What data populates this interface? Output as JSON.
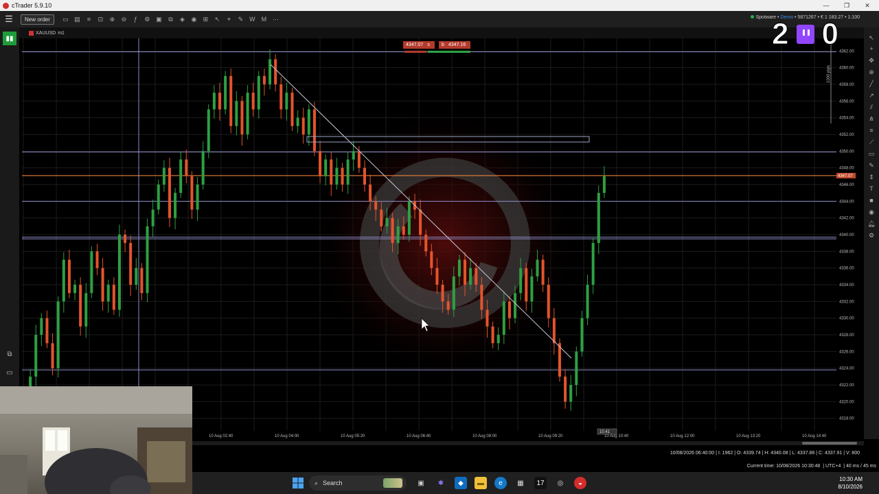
{
  "window": {
    "title": "cTrader 5.9.10"
  },
  "toolbar": {
    "new_order_label": "New order",
    "account": {
      "broker": "Spotware",
      "mode": "Demo",
      "info": "5871267 • € 1 183.27 • 1:100"
    }
  },
  "chart_tab": {
    "symbol": "XAUUSD",
    "timeframe": "m1"
  },
  "quotes": {
    "sell": "4347.07",
    "buy": "4347.16",
    "sell_mark": "s",
    "buy_mark": "b"
  },
  "overlay": {
    "left_digit": "2",
    "right_digit": "0"
  },
  "chart_data": {
    "type": "candlestick",
    "y_axis_labels": [
      "4362.00",
      "4360.00",
      "4358.00",
      "4356.00",
      "4354.00",
      "4352.00",
      "4350.00",
      "4348.00",
      "4346.00",
      "4344.00",
      "4342.00",
      "4340.00",
      "4338.00",
      "4336.00",
      "4334.00",
      "4332.00",
      "4330.00",
      "4328.00",
      "4326.00",
      "4324.00",
      "4322.00",
      "4320.00",
      "4318.00"
    ],
    "x_axis_labels": [
      "10 Aug 02:40",
      "10 Aug 04:00",
      "10 Aug 05:20",
      "10 Aug 06:40",
      "10 Aug 08:00",
      "10 Aug 09:20",
      "10 Aug 10:40",
      "10 Aug 12:00",
      "10 Aug 13:20",
      "10 Aug 14:40"
    ],
    "current_price": "4347.07",
    "price_range": [
      4316.5,
      4363.5
    ],
    "pip_label": "1000 pips",
    "cursor_time_label": "10.41",
    "horizontal_levels": [
      4361.9,
      4349.9,
      4344.0,
      4339.5,
      4339.7,
      4323.8
    ],
    "level_color": "#8e8ec8",
    "current_line_color": "#e8823a",
    "bull_color": "#2ea043",
    "bear_color": "#e4542c",
    "candles_close_path": [
      4318,
      4323,
      4328,
      4330,
      4327,
      4324,
      4332,
      4337,
      4333,
      4334,
      4329,
      4333,
      4338,
      4336,
      4332,
      4334,
      4331,
      4340,
      4339,
      4334,
      4336,
      4333,
      4341,
      4343,
      4346,
      4348,
      4342,
      4345,
      4349,
      4347,
      4343,
      4346,
      4350,
      4355,
      4357,
      4355,
      4359,
      4353,
      4356,
      4352,
      4357,
      4355,
      4359,
      4358,
      4361,
      4358,
      4355,
      4357,
      4353,
      4354,
      4352,
      4355,
      4350,
      4347,
      4349,
      4346,
      4348,
      4346,
      4349,
      4350,
      4348,
      4346,
      4344,
      4343,
      4341,
      4342,
      4339,
      4341,
      4340,
      4344,
      4343,
      4340,
      4338,
      4336,
      4334,
      4332,
      4331,
      4335,
      4337,
      4334,
      4336,
      4334,
      4331,
      4329,
      4327,
      4328,
      4332,
      4330,
      4333,
      4336,
      4332,
      4335,
      4337,
      4334,
      4330,
      4327,
      4323,
      4320,
      4322,
      4326,
      4330,
      4334,
      4339,
      4345,
      4347
    ]
  },
  "status": {
    "bar_info": "10/08/2026 06:40:00 | I: 1962 | O: 4339.74 | H: 4340.08 | L: 4337.86 | C: 4337.91 | V: 800",
    "current_time": "Current time: 10/08/2026 10:30:48",
    "timezone": "UTC+4",
    "latency": "40 ms / 45 ms"
  },
  "taskbar": {
    "search_label": "Search",
    "time": "10:30 AM",
    "date": "8/10/2026"
  }
}
